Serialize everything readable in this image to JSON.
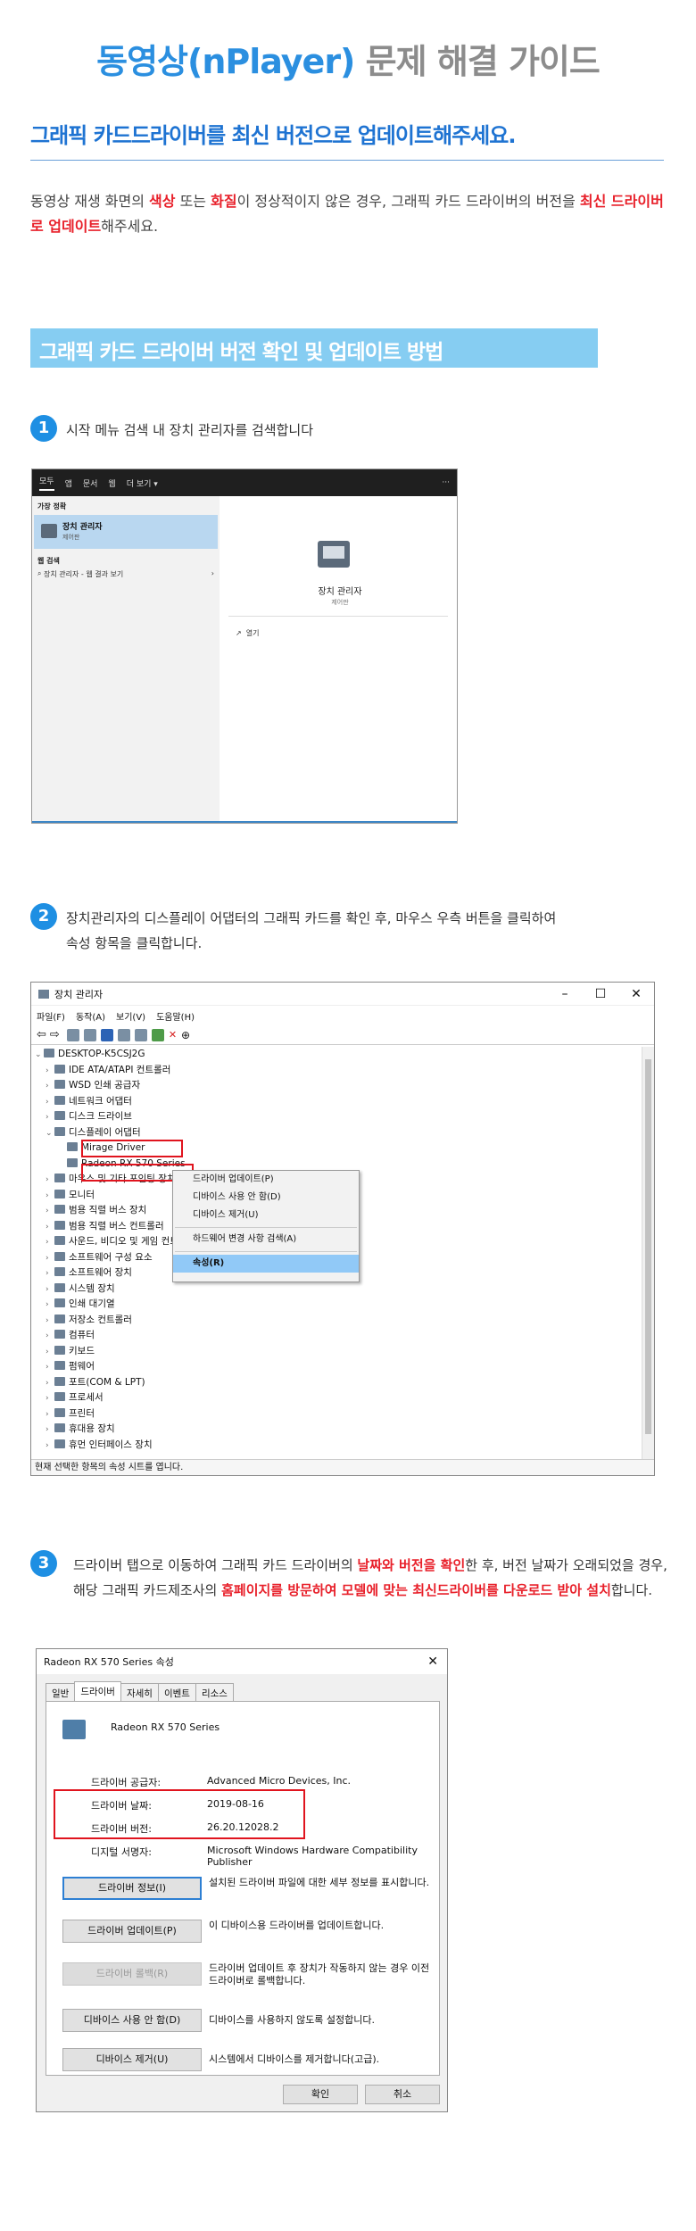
{
  "page": {
    "title_blue": "동영상(nPlayer)",
    "title_gray": "문제 해결 가이드",
    "section_heading": "그래픽 카드드라이버를 최신 버전으로 업데이트해주세요.",
    "intro": {
      "p1": "동영상 재생 화면의 ",
      "r1": "색상",
      "p2": " 또는 ",
      "r2": "화질",
      "p3": "이 정상적이지 않은 경우, 그래픽 카드 드라이버의 버전을 ",
      "r3": "최신 드라이버로 업데이트",
      "p4": "해주세요."
    },
    "banner": "그래픽 카드 드라이버 버전 확인 및 업데이트 방법"
  },
  "steps": [
    {
      "num": "1",
      "text": "시작 메뉴 검색 내 장치 관리자를  검색합니다"
    },
    {
      "num": "2",
      "line1": "장치관리자의 디스플레이 어댑터의 그래픽 카드를 확인 후, 마우스 우측 버튼을 클릭하여",
      "line2": "속성 항목을 클릭합니다."
    },
    {
      "num": "3",
      "a": "드라이버 탭으로 이동하여 그래픽 카드 드라이버의 ",
      "b": "날짜와 버전을 확인",
      "c": "한 후, 버전 날짜가 오래되었을 경우,",
      "d": "해당 그래픽 카드제조사의 ",
      "e": "홈페이지를 방문하여 모델에 맞는 최신드라이버를 다운로드 받아 설치",
      "f": "합니다."
    }
  ],
  "start_menu": {
    "tabs": [
      "모두",
      "앱",
      "문서",
      "웹",
      "더 보기 ▾"
    ],
    "more": "···",
    "best_match_label": "가장 정확",
    "best_name": "장치 관리자",
    "best_sub": "제어판",
    "web_label": "웹 검색",
    "web_item": "장치 관리자 - 웹 결과 보기",
    "right_name": "장치 관리자",
    "right_sub": "제어판",
    "open": "열기"
  },
  "device_manager": {
    "title": "장치 관리자",
    "menus": [
      "파일(F)",
      "동작(A)",
      "보기(V)",
      "도움말(H)"
    ],
    "root": "DESKTOP-K5CSJ2G",
    "tree": [
      "IDE ATA/ATAPI 컨트롤러",
      "WSD 인쇄 공급자",
      "네트워크 어댑터",
      "디스크 드라이브",
      "디스플레이 어댑터",
      "Mirage Driver",
      "Radeon RX 570 Series",
      "마우스 및 기타 포인팅 장치",
      "모니터",
      "범용 직렬 버스 장치",
      "범용 직렬 버스 컨트롤러",
      "사운드, 비디오 및 게임 컨트롤러",
      "소프트웨어 구성 요소",
      "소프트웨어 장치",
      "시스템 장치",
      "인쇄 대기열",
      "저장소 컨트롤러",
      "컴퓨터",
      "키보드",
      "펌웨어",
      "포트(COM & LPT)",
      "프로세서",
      "프린터",
      "휴대용 장치",
      "휴먼 인터페이스 장치"
    ],
    "context_menu": [
      "드라이버 업데이트(P)",
      "디바이스 사용 안 함(D)",
      "디바이스 제거(U)",
      "하드웨어 변경 사항 검색(A)",
      "속성(R)"
    ],
    "status": "현재 선택한 항목의 속성 시트를 엽니다."
  },
  "properties": {
    "title": "Radeon RX 570 Series 속성",
    "tabs": [
      "일반",
      "드라이버",
      "자세히",
      "이벤트",
      "리소스"
    ],
    "device_name": "Radeon RX 570 Series",
    "provider_label": "드라이버 공급자:",
    "provider_value": "Advanced Micro Devices, Inc.",
    "date_label": "드라이버 날짜:",
    "date_value": "2019-08-16",
    "version_label": "드라이버 버전:",
    "version_value": "26.20.12028.2",
    "signer_label": "디지털 서명자:",
    "signer_value": "Microsoft Windows Hardware Compatibility Publisher",
    "buttons": [
      {
        "label": "드라이버 정보(I)",
        "desc": "설치된 드라이버 파일에 대한 세부 정보를 표시합니다."
      },
      {
        "label": "드라이버 업데이트(P)",
        "desc": "이 디바이스용 드라이버를 업데이트합니다."
      },
      {
        "label": "드라이버 롤백(R)",
        "desc": "드라이버 업데이트 후 장치가 작동하지 않는 경우 이전 드라이버로 롤백합니다."
      },
      {
        "label": "디바이스 사용 안 함(D)",
        "desc": "디바이스를 사용하지 않도록 설정합니다."
      },
      {
        "label": "디바이스 제거(U)",
        "desc": "시스템에서 디바이스를 제거합니다(고급)."
      }
    ],
    "ok": "확인",
    "cancel": "취소"
  }
}
